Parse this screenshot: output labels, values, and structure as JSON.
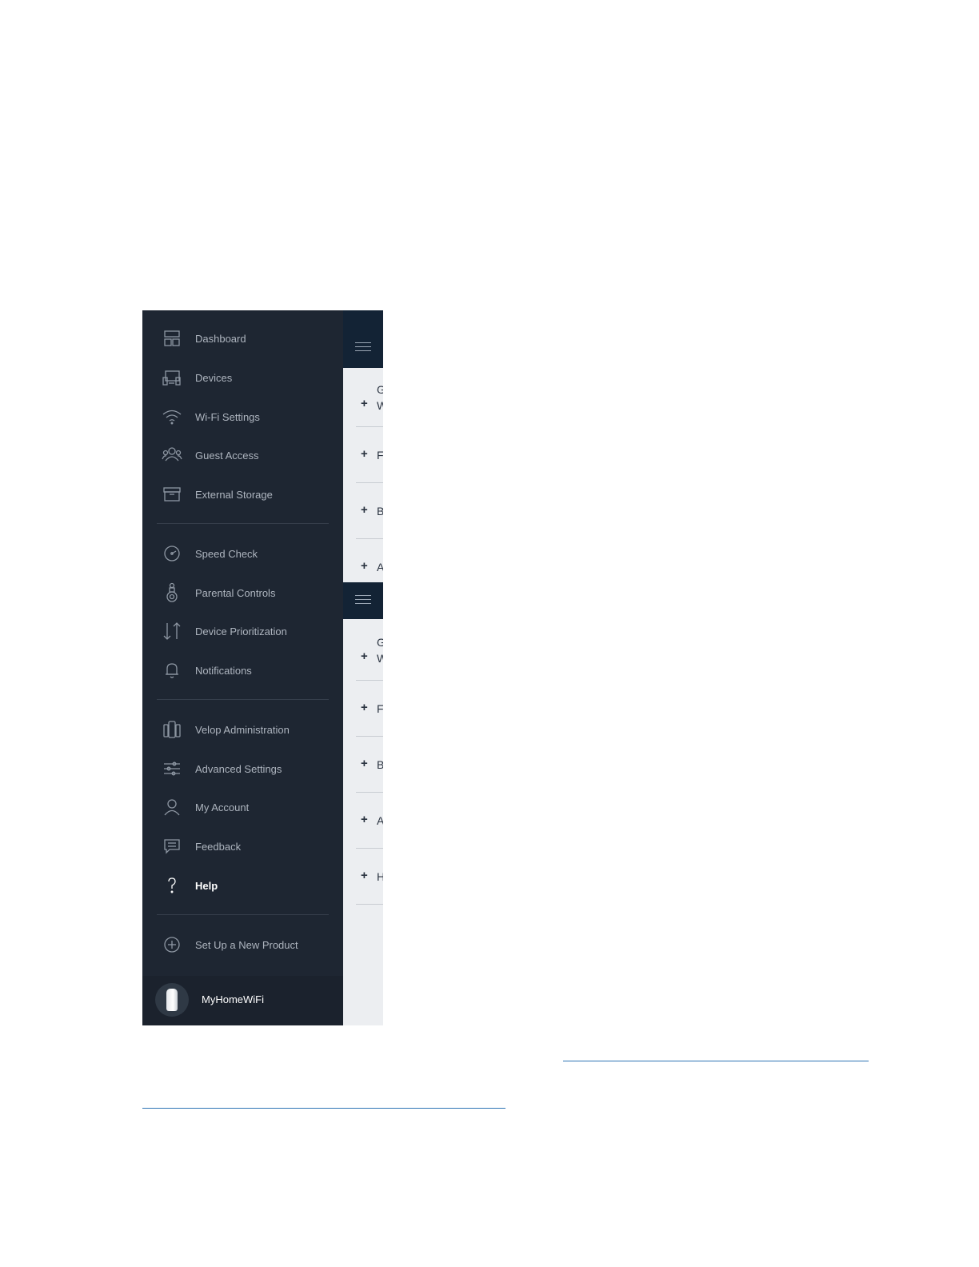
{
  "sidebar": {
    "items": [
      {
        "label": "Dashboard",
        "icon": "dashboard-icon"
      },
      {
        "label": "Devices",
        "icon": "devices-icon"
      },
      {
        "label": "Wi-Fi Settings",
        "icon": "wifi-icon"
      },
      {
        "label": "Guest Access",
        "icon": "guest-icon"
      },
      {
        "label": "External Storage",
        "icon": "storage-icon"
      },
      {
        "label": "Speed Check",
        "icon": "speedometer-icon"
      },
      {
        "label": "Parental Controls",
        "icon": "parental-controls-icon"
      },
      {
        "label": "Device Prioritization",
        "icon": "prioritization-arrows-icon"
      },
      {
        "label": "Notifications",
        "icon": "bell-icon"
      },
      {
        "label": "Velop Administration",
        "icon": "velop-nodes-icon"
      },
      {
        "label": "Advanced Settings",
        "icon": "sliders-icon"
      },
      {
        "label": "My Account",
        "icon": "user-icon"
      },
      {
        "label": "Feedback",
        "icon": "feedback-icon"
      },
      {
        "label": "Help",
        "icon": "question-icon",
        "active": true
      },
      {
        "label": "Set Up a New Product",
        "icon": "plus-circle-icon"
      }
    ],
    "network_name": "MyHomeWiFi"
  },
  "panel": {
    "plus": "+",
    "top_rows": [
      "G",
      "F",
      "B",
      "A"
    ],
    "top_row0_line2": "W",
    "bottom_rows": [
      "G",
      "F",
      "B",
      "A",
      "H"
    ],
    "bottom_row0_line2": "W"
  },
  "colors": {
    "sidebar_bg": "#1e2632",
    "panel_header_bg": "#132335",
    "panel_bg": "#eceef1",
    "link": "#2e74b5"
  }
}
